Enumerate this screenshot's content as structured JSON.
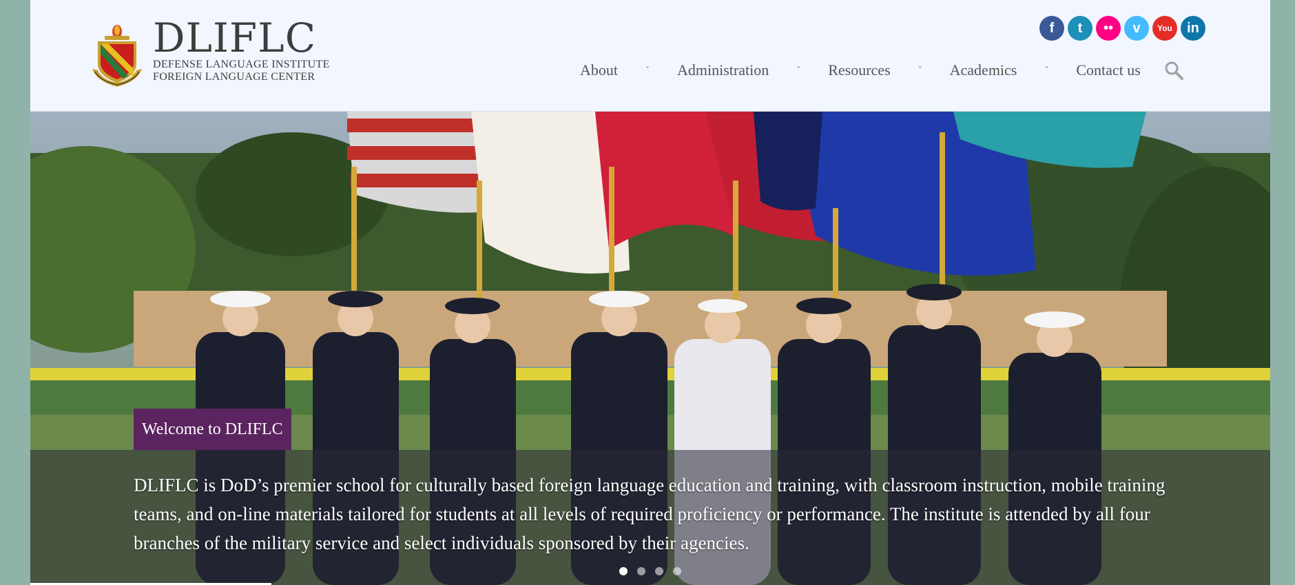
{
  "brand": {
    "title": "DLIFLC",
    "subtitle_line1": "DEFENSE LANGUAGE INSTITUTE",
    "subtitle_line2": "FOREIGN LANGUAGE CENTER",
    "crest_icon": "dliflc-crest-icon"
  },
  "social": [
    {
      "name": "facebook",
      "glyph": "f",
      "color": "#3b5998"
    },
    {
      "name": "twitter",
      "glyph": "t",
      "color": "#1d8fb8"
    },
    {
      "name": "flickr",
      "glyph": "••",
      "color": "#ff0084"
    },
    {
      "name": "vimeo",
      "glyph": "v",
      "color": "#44bbff"
    },
    {
      "name": "youtube",
      "glyph": "You",
      "color": "#e52d27"
    },
    {
      "name": "linkedin",
      "glyph": "in",
      "color": "#0e76a8"
    }
  ],
  "nav": {
    "items": [
      {
        "label": "About",
        "has_dropdown": true
      },
      {
        "label": "Administration",
        "has_dropdown": true
      },
      {
        "label": "Resources",
        "has_dropdown": true
      },
      {
        "label": "Academics",
        "has_dropdown": true
      },
      {
        "label": "Contact us",
        "has_dropdown": false
      }
    ],
    "chevron": "˅",
    "search_icon": "search-icon"
  },
  "hero": {
    "badge": "Welcome to DLIFLC",
    "text": "DLIFLC is DoD’s premier school for culturally based foreign language education and training, with classroom instruction, mobile training teams, and on-line materials tailored for students at all levels of required proficiency or performance. The institute is attended by all four branches of the military service and select individuals sponsored by their agencies.",
    "slides_total": 4,
    "active_slide": 1,
    "image": "color-guard-flags-photo"
  },
  "colors": {
    "badge_bg": "#5b2460",
    "header_bg": "#f2f6ff",
    "page_bg": "#8fb3a9"
  }
}
